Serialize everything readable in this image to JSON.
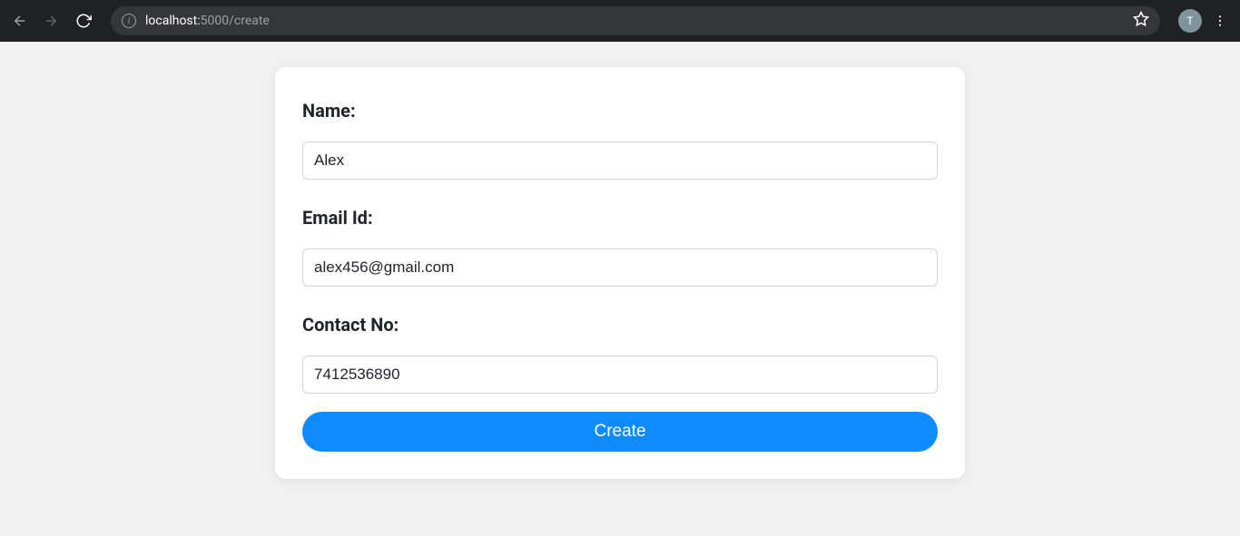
{
  "browser": {
    "url_host": "localhost:",
    "url_path": "5000/create",
    "avatar_letter": "T"
  },
  "form": {
    "name_label": "Name:",
    "name_value": "Alex",
    "email_label": "Email Id:",
    "email_value": "alex456@gmail.com",
    "contact_label": "Contact No:",
    "contact_value": "7412536890",
    "submit_label": "Create"
  }
}
